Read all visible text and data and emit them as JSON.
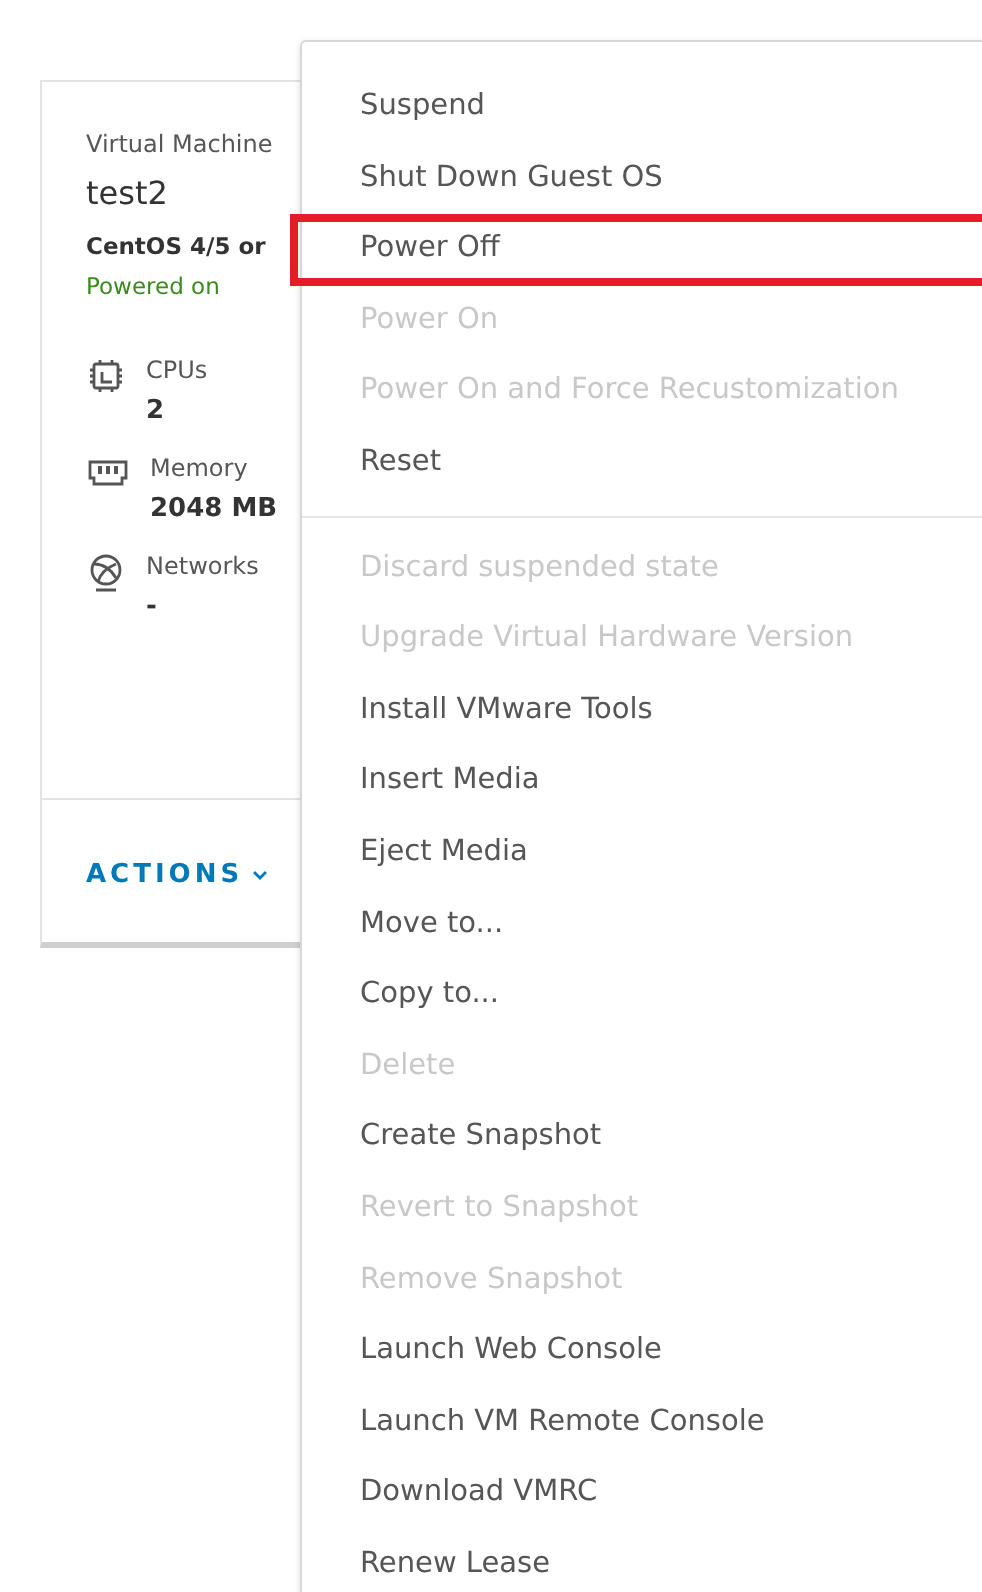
{
  "card": {
    "type_label": "Virtual Machine",
    "name": "test2",
    "guest_os": "CentOS 4/5 or",
    "power_state": "Powered on",
    "specs": [
      {
        "kind": "cpu",
        "label": "CPUs",
        "value": "2"
      },
      {
        "kind": "memory",
        "label": "Memory",
        "value": "2048 MB"
      },
      {
        "kind": "network",
        "label": "Networks",
        "value": "-"
      }
    ],
    "actions_button": "ACTIONS"
  },
  "menu": {
    "groups": [
      [
        {
          "label": "Suspend",
          "disabled": false,
          "highlighted": false
        },
        {
          "label": "Shut Down Guest OS",
          "disabled": false,
          "highlighted": false
        },
        {
          "label": "Power Off",
          "disabled": false,
          "highlighted": true
        },
        {
          "label": "Power On",
          "disabled": true,
          "highlighted": false
        },
        {
          "label": "Power On and Force Recustomization",
          "disabled": true,
          "highlighted": false
        },
        {
          "label": "Reset",
          "disabled": false,
          "highlighted": false
        }
      ],
      [
        {
          "label": "Discard suspended state",
          "disabled": true,
          "highlighted": false
        },
        {
          "label": "Upgrade Virtual Hardware Version",
          "disabled": true,
          "highlighted": false
        },
        {
          "label": "Install VMware Tools",
          "disabled": false,
          "highlighted": false
        },
        {
          "label": "Insert Media",
          "disabled": false,
          "highlighted": false
        },
        {
          "label": "Eject Media",
          "disabled": false,
          "highlighted": false
        },
        {
          "label": "Move to...",
          "disabled": false,
          "highlighted": false
        },
        {
          "label": "Copy to...",
          "disabled": false,
          "highlighted": false
        },
        {
          "label": "Delete",
          "disabled": true,
          "highlighted": false
        },
        {
          "label": "Create Snapshot",
          "disabled": false,
          "highlighted": false
        },
        {
          "label": "Revert to Snapshot",
          "disabled": true,
          "highlighted": false
        },
        {
          "label": "Remove Snapshot",
          "disabled": true,
          "highlighted": false
        },
        {
          "label": "Launch Web Console",
          "disabled": false,
          "highlighted": false
        },
        {
          "label": "Launch VM Remote Console",
          "disabled": false,
          "highlighted": false
        },
        {
          "label": "Download VMRC",
          "disabled": false,
          "highlighted": false
        },
        {
          "label": "Renew Lease",
          "disabled": false,
          "highlighted": false
        }
      ]
    ]
  }
}
